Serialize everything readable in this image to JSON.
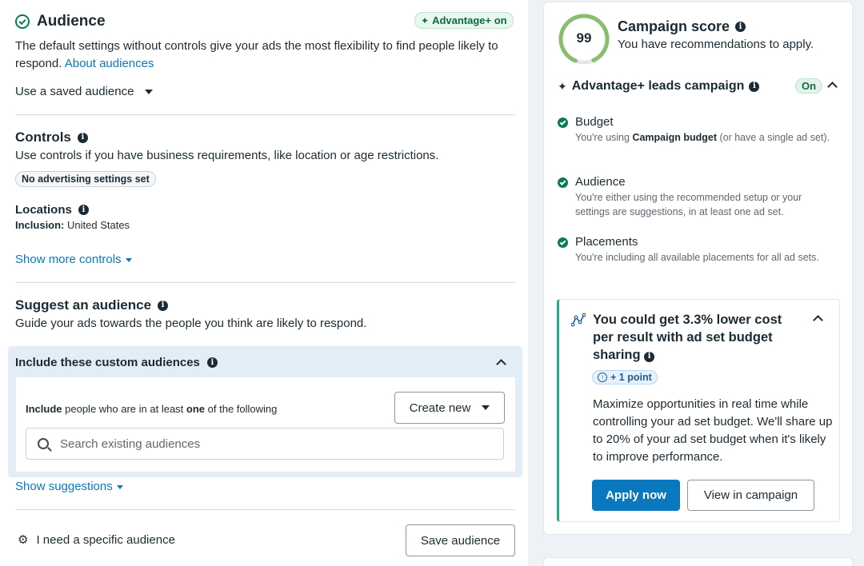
{
  "audience": {
    "title": "Audience",
    "badge": "Advantage+ on",
    "description": "The default settings without controls give your ads the most flexibility to find people likely to respond.",
    "about_link": "About audiences",
    "saved_audience": "Use a saved audience"
  },
  "controls": {
    "title": "Controls",
    "description": "Use controls if you have business requirements, like location or age restrictions.",
    "pill": "No advertising settings set",
    "locations_label": "Locations",
    "inclusion_label": "Inclusion:",
    "inclusion_value": "United States",
    "show_more": "Show more controls"
  },
  "suggest": {
    "title": "Suggest an audience",
    "description": "Guide your ads towards the people you think are likely to respond."
  },
  "custom": {
    "title": "Include these custom audiences",
    "include_prefix": "Include",
    "include_mid": "people who are in at least",
    "include_one": "one",
    "include_suffix": "of the following",
    "create_new": "Create new",
    "search_placeholder": "Search existing audiences",
    "show_suggestions": "Show suggestions"
  },
  "footer": {
    "specific": "I need a specific audience",
    "save": "Save audience"
  },
  "score": {
    "value": "99",
    "ring_fraction": 0.99,
    "title": "Campaign score",
    "subtitle": "You have recommendations to apply."
  },
  "advantage": {
    "title": "Advantage+ leads campaign",
    "status": "On",
    "items": [
      {
        "title": "Budget",
        "desc_prefix": "You're using ",
        "desc_bold": "Campaign budget",
        "desc_suffix": " (or have a single ad set)."
      },
      {
        "title": "Audience",
        "desc": "You're either using the recommended setup or your settings are suggestions, in at least one ad set."
      },
      {
        "title": "Placements",
        "desc": "You're including all available placements for all ad sets."
      }
    ]
  },
  "recommendation": {
    "title": "You could get 3.3% lower cost per result with ad set budget sharing",
    "points": "+ 1 point",
    "description": "Maximize opportunities in real time while controlling your ad set budget. We'll share up to 20% of your ad set budget when it's likely to improve performance.",
    "apply": "Apply now",
    "view": "View in campaign"
  },
  "colors": {
    "accent": "#0a78be",
    "success": "#0a7c55",
    "score_ring": "#8bbd6e"
  }
}
